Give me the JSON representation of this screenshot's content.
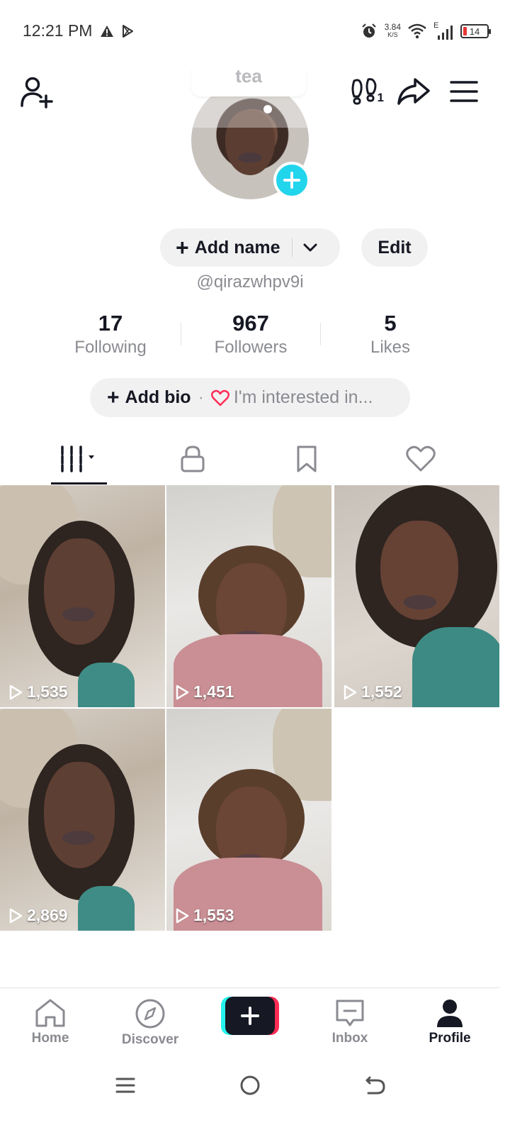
{
  "status_bar": {
    "time": "12:21 PM",
    "network_speed_value": "3.84",
    "network_speed_unit": "K/S",
    "network_type": "E",
    "battery_level": "14",
    "icons": [
      "warning-icon",
      "play-store-icon",
      "alarm-icon",
      "wifi-icon",
      "signal-icon",
      "battery-icon"
    ]
  },
  "top_bar": {
    "icons": [
      "add-friend-icon",
      "footsteps-icon",
      "share-icon",
      "menu-icon"
    ],
    "profile_views_count": "1"
  },
  "profile": {
    "note_text": "tea",
    "add_name_label": "Add name",
    "edit_label": "Edit",
    "username": "@qirazwhpv9i",
    "stats": [
      {
        "value": "17",
        "label": "Following"
      },
      {
        "value": "967",
        "label": "Followers"
      },
      {
        "value": "5",
        "label": "Likes"
      }
    ],
    "add_bio_label": "Add bio",
    "bio_separator": "·",
    "interests_label": "I'm interested in..."
  },
  "tabs": {
    "items": [
      "videos-grid-icon",
      "lock-icon",
      "bookmark-icon",
      "heart-icon"
    ],
    "active_index": 0
  },
  "videos": [
    {
      "views": "1,535"
    },
    {
      "views": "1,451"
    },
    {
      "views": "1,552"
    },
    {
      "views": "2,869"
    },
    {
      "views": "1,553"
    }
  ],
  "bottom_nav": {
    "items": [
      {
        "label": "Home",
        "icon": "home-icon"
      },
      {
        "label": "Discover",
        "icon": "compass-icon"
      },
      {
        "label": "",
        "icon": "create-plus-icon"
      },
      {
        "label": "Inbox",
        "icon": "inbox-icon"
      },
      {
        "label": "Profile",
        "icon": "profile-icon"
      }
    ],
    "active": "Profile"
  },
  "colors": {
    "accent_cyan": "#20d5ec",
    "brand_pink": "#fe2c55",
    "brand_teal": "#25f4ee",
    "text_primary": "#161823",
    "text_secondary": "#8a8b91",
    "pill_bg": "#f1f1f2"
  }
}
